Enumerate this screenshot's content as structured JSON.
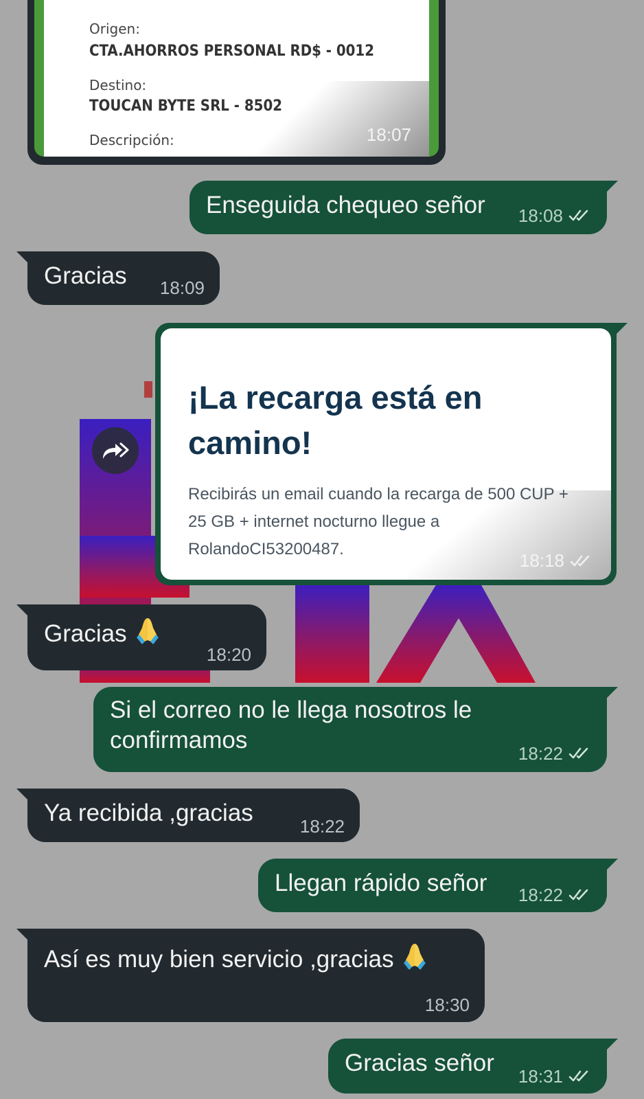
{
  "receipt": {
    "origin_label": "Origen:",
    "origin_value": "CTA.AHORROS PERSONAL RD$ - 0012",
    "dest_label": "Destino:",
    "dest_value": "TOUCAN BYTE SRL - 8502",
    "desc_label": "Descripción:",
    "time": "18:07"
  },
  "messages": [
    {
      "dir": "out",
      "text": "Enseguida chequeo señor",
      "time": "18:08",
      "status": "read"
    },
    {
      "dir": "in",
      "text": "Gracias",
      "time": "18:09"
    },
    {
      "dir": "in",
      "text": "Gracias",
      "time": "18:20",
      "emoji": "folded-hands"
    },
    {
      "dir": "out",
      "text_line1": "Si el correo no le llega nosotros le",
      "text_line2": "confirmamos",
      "time": "18:22",
      "status": "read"
    },
    {
      "dir": "in",
      "text": "Ya recibida ,gracias",
      "time": "18:22"
    },
    {
      "dir": "out",
      "text": "Llegan rápido señor",
      "time": "18:22",
      "status": "read"
    },
    {
      "dir": "in",
      "text": "Así es muy bien servicio ,gracias",
      "time": "18:30",
      "emoji": "folded-hands"
    },
    {
      "dir": "out",
      "text": "Gracias señor",
      "time": "18:31",
      "status": "read"
    }
  ],
  "recharge_card": {
    "title": "¡La recarga está en camino!",
    "body": "Recibirás un email cuando la recarga de 500 CUP + 25 GB + internet nocturno llegue a RolandoCI53200487.",
    "time": "18:18",
    "status": "read"
  },
  "colors": {
    "background": "#a8a8a8",
    "incoming_bubble": "#222a2f",
    "outgoing_bubble": "#16513a",
    "card_title": "#14344f"
  },
  "icons": {
    "forward": "forward-icon",
    "read_ticks": "double-check-icon",
    "emoji": "folded-hands-emoji"
  }
}
